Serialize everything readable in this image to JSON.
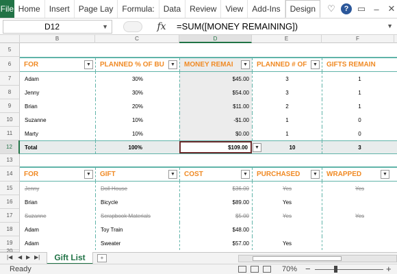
{
  "ribbon": {
    "file": "File",
    "tabs": [
      "Home",
      "Insert",
      "Page Lay",
      "Formula:",
      "Data",
      "Review",
      "View",
      "Add-Ins",
      "Design"
    ],
    "icons": [
      "heart-icon",
      "help-icon",
      "restore-icon",
      "minimize-icon",
      "close-icon"
    ]
  },
  "formula_bar": {
    "name_box": "D12",
    "fx": "fx",
    "formula": "=SUM([MONEY REMAINING])"
  },
  "columns": [
    "B",
    "C",
    "D",
    "E",
    "F"
  ],
  "selected_column": "D",
  "rows": {
    "r5": "5",
    "r6": "6",
    "r7": "7",
    "r8": "8",
    "r9": "9",
    "r10": "10",
    "r11": "11",
    "r12": "12",
    "r13": "13",
    "r14": "14",
    "r15": "15",
    "r16": "16",
    "r17": "17",
    "r18": "18",
    "r19": "19",
    "r20": "20"
  },
  "table1": {
    "headers": [
      "FOR",
      "PLANNED % OF BU",
      "MONEY REMAI",
      "PLANNED # OF",
      "GIFTS REMAIN"
    ],
    "rows": [
      [
        "Adam",
        "30%",
        "$45.00",
        "3",
        "1"
      ],
      [
        "Jenny",
        "30%",
        "$54.00",
        "3",
        "1"
      ],
      [
        "Brian",
        "20%",
        "$11.00",
        "2",
        "1"
      ],
      [
        "Suzanne",
        "10%",
        "-$1.00",
        "1",
        "0"
      ],
      [
        "Marty",
        "10%",
        "$0.00",
        "1",
        "0"
      ]
    ],
    "total": [
      "Total",
      "100%",
      "$109.00",
      "10",
      "3"
    ]
  },
  "table2": {
    "headers": [
      "FOR",
      "GIFT",
      "COST",
      "PURCHASED",
      "WRAPPED"
    ],
    "rows": [
      {
        "cells": [
          "Jenny",
          "Doll House",
          "$36.00",
          "Yes",
          "Yes"
        ],
        "strike": true
      },
      {
        "cells": [
          "Brian",
          "Bicycle",
          "$89.00",
          "Yes",
          ""
        ],
        "strike": false
      },
      {
        "cells": [
          "Suzanne",
          "Scrapbook Materials",
          "$5.00",
          "Yes",
          "Yes"
        ],
        "strike": true
      },
      {
        "cells": [
          "Adam",
          "Toy Train",
          "$48.00",
          "",
          ""
        ],
        "strike": false
      },
      {
        "cells": [
          "Adam",
          "Sweater",
          "$57.00",
          "Yes",
          ""
        ],
        "strike": false
      }
    ]
  },
  "sheet_tabs": {
    "active": "Gift List"
  },
  "status": {
    "ready": "Ready",
    "zoom": "70%"
  },
  "colors": {
    "accent_green": "#217346",
    "header_orange": "#f08a24",
    "teal_border": "#5fb3a8"
  }
}
